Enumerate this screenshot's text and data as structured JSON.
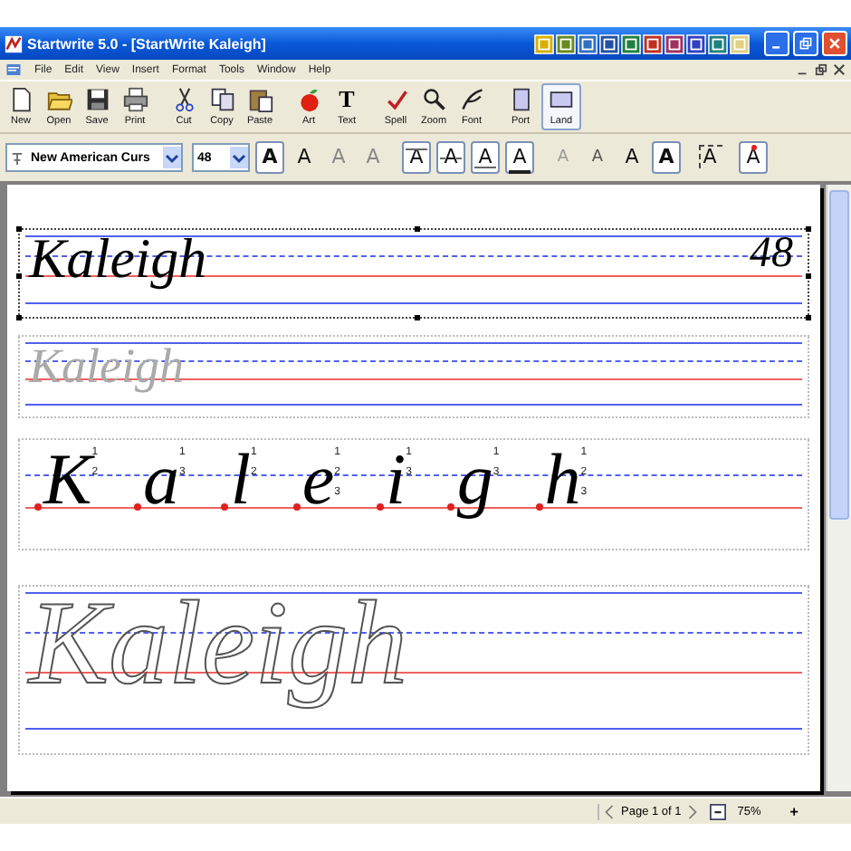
{
  "window": {
    "title": "Startwrite 5.0 - [StartWrite Kaleigh]"
  },
  "menu": [
    "File",
    "Edit",
    "View",
    "Insert",
    "Format",
    "Tools",
    "Window",
    "Help"
  ],
  "toolbar": [
    {
      "label": "New",
      "kind": "new",
      "selected": false
    },
    {
      "label": "Open",
      "kind": "open",
      "selected": false
    },
    {
      "label": "Save",
      "kind": "save",
      "selected": false
    },
    {
      "label": "Print",
      "kind": "print",
      "selected": false
    },
    {
      "label": "Cut",
      "kind": "cut",
      "selected": false
    },
    {
      "label": "Copy",
      "kind": "copy",
      "selected": false
    },
    {
      "label": "Paste",
      "kind": "paste",
      "selected": false
    },
    {
      "label": "Art",
      "kind": "art",
      "selected": false
    },
    {
      "label": "Text",
      "kind": "text",
      "glyph": "T",
      "selected": false
    },
    {
      "label": "Spell",
      "kind": "spell",
      "selected": false
    },
    {
      "label": "Zoom",
      "kind": "zoom",
      "selected": false
    },
    {
      "label": "Font",
      "kind": "font",
      "selected": false
    },
    {
      "label": "Port",
      "kind": "port",
      "selected": false
    },
    {
      "label": "Land",
      "kind": "land",
      "selected": true
    }
  ],
  "format_bar": {
    "font": "New American Curs",
    "size": "48",
    "styles": [
      {
        "glyph": "A",
        "kind": "bold",
        "selected": true,
        "disabled": false
      },
      {
        "glyph": "A",
        "kind": "plain",
        "selected": false,
        "disabled": false
      },
      {
        "glyph": "A",
        "kind": "plain",
        "selected": false,
        "disabled": true
      },
      {
        "glyph": "A",
        "kind": "plain",
        "selected": false,
        "disabled": true
      },
      {
        "glyph": "A",
        "kind": "topline",
        "selected": true,
        "disabled": false
      },
      {
        "glyph": "A",
        "kind": "midline",
        "selected": true,
        "disabled": false
      },
      {
        "glyph": "A",
        "kind": "baseline",
        "selected": true,
        "disabled": false
      },
      {
        "glyph": "A",
        "kind": "underline",
        "selected": true,
        "disabled": false
      },
      {
        "glyph": "A",
        "kind": "dotted",
        "selected": false,
        "disabled": true
      },
      {
        "glyph": "A",
        "kind": "dotted",
        "selected": false,
        "disabled": false
      },
      {
        "glyph": "A",
        "kind": "plain",
        "selected": false,
        "disabled": false
      },
      {
        "glyph": "A",
        "kind": "bold",
        "selected": true,
        "disabled": false
      },
      {
        "glyph": "A",
        "kind": "arrows",
        "selected": false,
        "disabled": false
      },
      {
        "glyph": "A",
        "kind": "startdot",
        "selected": true,
        "disabled": false
      }
    ]
  },
  "lines": [
    {
      "kind": "solid",
      "text": "Kaleigh",
      "size_label": "48",
      "selected": true
    },
    {
      "kind": "dotted",
      "text": "Kaleigh",
      "selected": false
    },
    {
      "kind": "guided",
      "selected": false,
      "letters": [
        {
          "char": "K",
          "strokes": [
            "1",
            "2"
          ]
        },
        {
          "char": "a",
          "strokes": [
            "1",
            "3"
          ]
        },
        {
          "char": "l",
          "strokes": [
            "1",
            "2"
          ]
        },
        {
          "char": "e",
          "strokes": [
            "1",
            "2",
            "3"
          ]
        },
        {
          "char": "i",
          "strokes": [
            "1",
            "3"
          ]
        },
        {
          "char": "g",
          "strokes": [
            "1",
            "3"
          ]
        },
        {
          "char": "h",
          "strokes": [
            "1",
            "2",
            "3"
          ]
        }
      ]
    },
    {
      "kind": "outline",
      "text": "Kaleigh",
      "selected": false
    }
  ],
  "status_bar": {
    "page": "Page 1 of 1",
    "zoom": "75%",
    "zoom_in": "+"
  }
}
